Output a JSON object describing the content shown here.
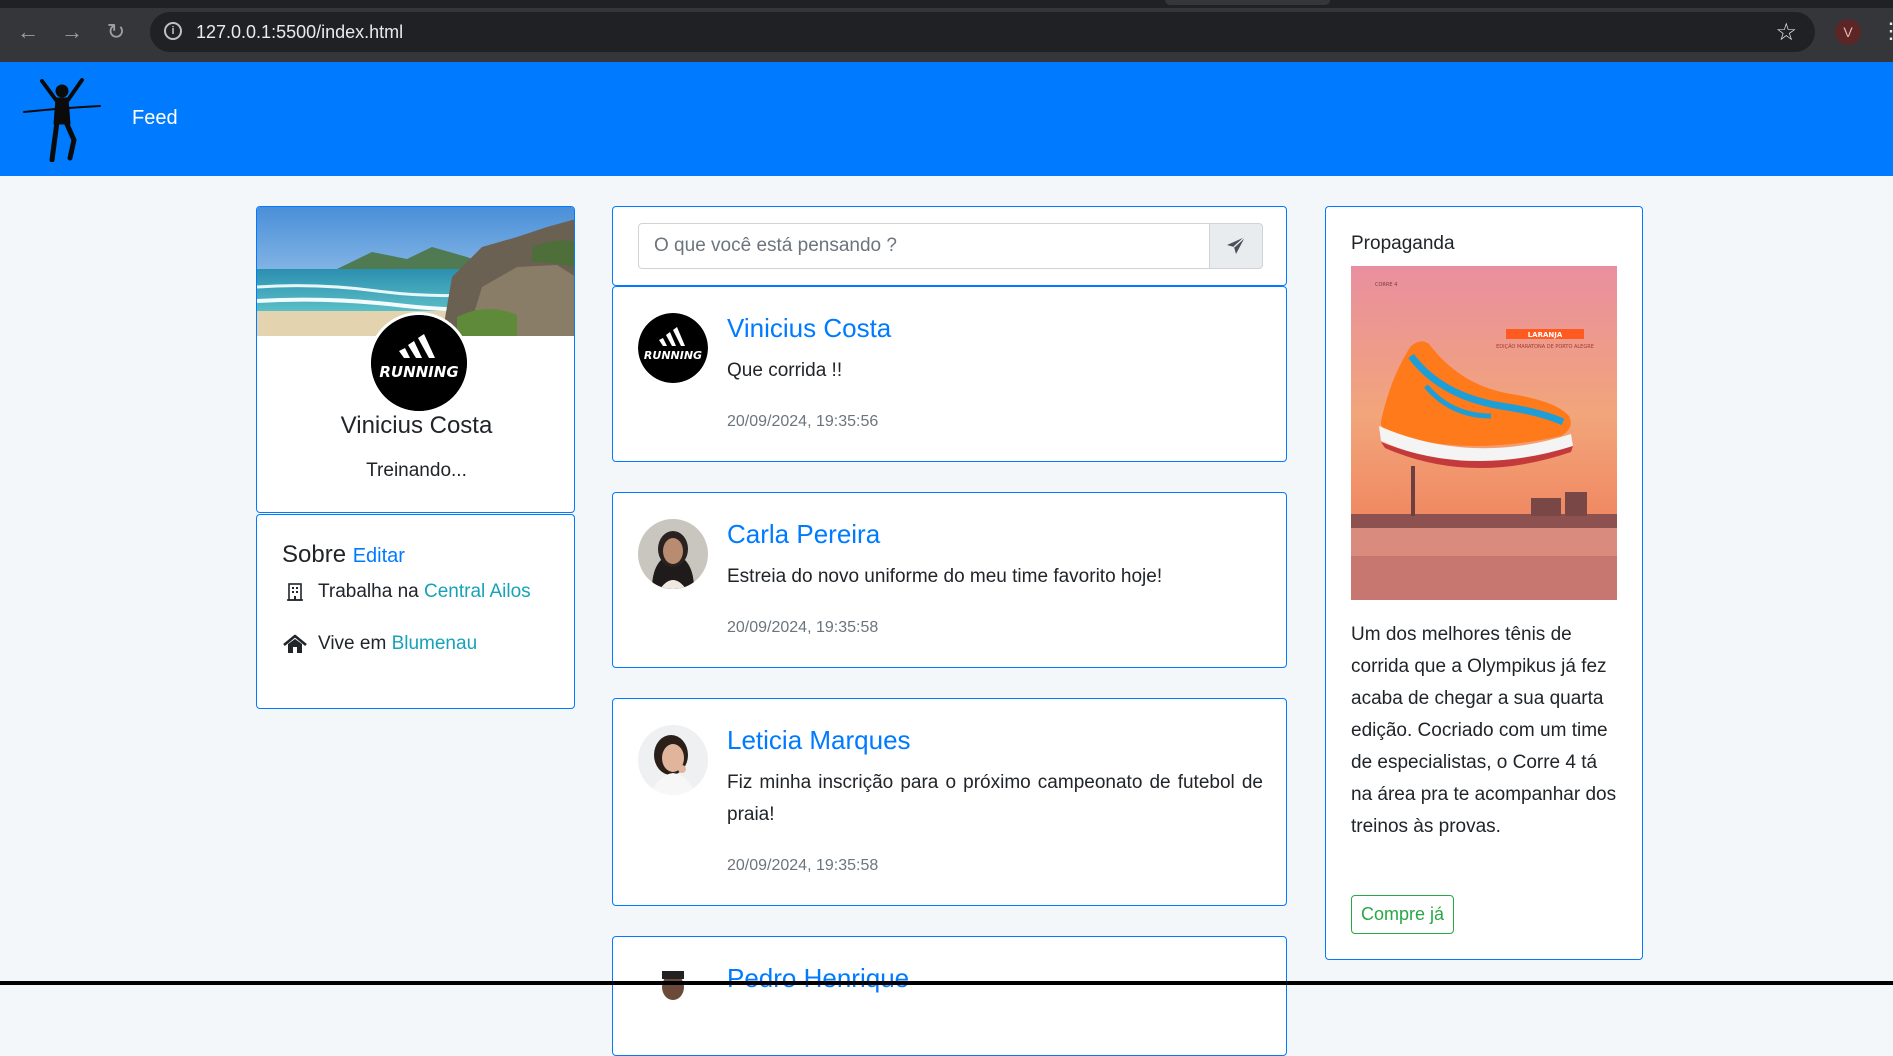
{
  "browser": {
    "url": "127.0.0.1:5500/index.html",
    "profile_initial": "V"
  },
  "app": {
    "nav_feed": "Feed"
  },
  "profile": {
    "name": "Vinicius Costa",
    "status": "Treinando...",
    "avatar_text": "RUNNING"
  },
  "about": {
    "title": "Sobre",
    "edit": "Editar",
    "work_prefix": "Trabalha na",
    "work_place": "Central Ailos",
    "live_prefix": "Vive em",
    "live_place": "Blumenau"
  },
  "composer": {
    "placeholder": "O que você está pensando ?"
  },
  "posts": [
    {
      "author": "Vinicius Costa",
      "text": "Que corrida !!",
      "time": "20/09/2024, 19:35:56"
    },
    {
      "author": "Carla Pereira",
      "text": "Estreia do novo uniforme do meu time favorito hoje!",
      "time": "20/09/2024, 19:35:58"
    },
    {
      "author": "Leticia Marques",
      "text": "Fiz minha inscrição para o próximo campeonato de futebol de praia!",
      "time": "20/09/2024, 19:35:58"
    },
    {
      "author": "Pedro Henrique"
    }
  ],
  "ad": {
    "title": "Propaganda",
    "text": "Um dos melhores tênis de corrida que a Olympikus já fez acaba de chegar a sua quarta edição. Cocriado com um time de especialistas, o Corre 4 tá na área pra te acompanhar dos treinos às provas.",
    "button": "Compre já",
    "image_label": "LARANJA",
    "image_sublabel": "EDIÇÃO MARATONA DE PORTO ALEGRE",
    "image_brand": "CORRE 4"
  },
  "colors": {
    "primary": "#007bff",
    "info": "#17a2b8",
    "success": "#28a745"
  }
}
